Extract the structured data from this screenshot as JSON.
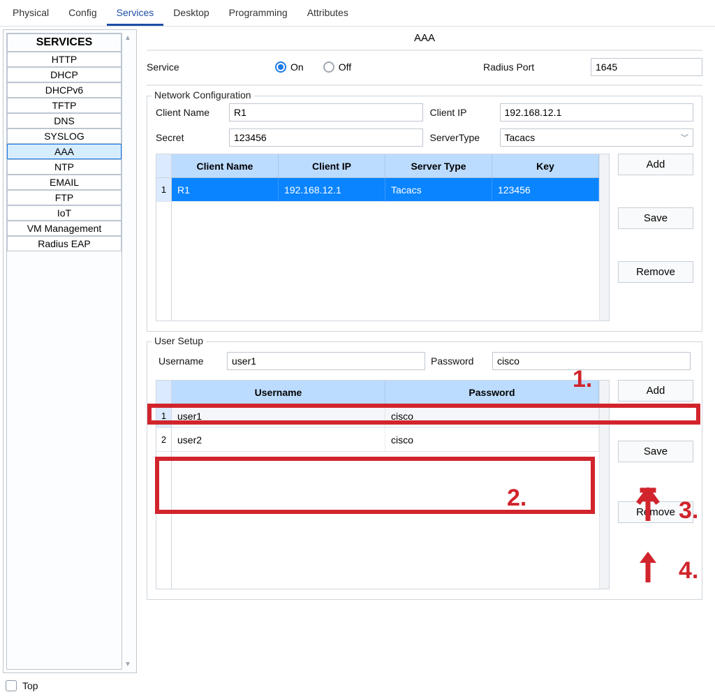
{
  "tabs": [
    "Physical",
    "Config",
    "Services",
    "Desktop",
    "Programming",
    "Attributes"
  ],
  "active_tab": "Services",
  "sidebar": {
    "title": "SERVICES",
    "items": [
      "HTTP",
      "DHCP",
      "DHCPv6",
      "TFTP",
      "DNS",
      "SYSLOG",
      "AAA",
      "NTP",
      "EMAIL",
      "FTP",
      "IoT",
      "VM Management",
      "Radius EAP"
    ],
    "selected": "AAA"
  },
  "page": {
    "title": "AAA",
    "service_label": "Service",
    "on_label": "On",
    "off_label": "Off",
    "service_on": true,
    "radius_port_label": "Radius Port",
    "radius_port": "1645"
  },
  "network_config": {
    "legend": "Network Configuration",
    "client_name_label": "Client Name",
    "client_name": "R1",
    "client_ip_label": "Client IP",
    "client_ip": "192.168.12.1",
    "secret_label": "Secret",
    "secret": "123456",
    "server_type_label": "ServerType",
    "server_type": "Tacacs",
    "headers": [
      "Client Name",
      "Client IP",
      "Server Type",
      "Key"
    ],
    "rows": [
      {
        "n": "1",
        "client": "R1",
        "ip": "192.168.12.1",
        "type": "Tacacs",
        "key": "123456",
        "selected": true
      }
    ]
  },
  "user_setup": {
    "legend": "User Setup",
    "username_label": "Username",
    "username": "user1",
    "password_label": "Password",
    "password": "cisco",
    "headers": [
      "Username",
      "Password"
    ],
    "rows": [
      {
        "n": "1",
        "user": "user1",
        "pass": "cisco",
        "alt": true
      },
      {
        "n": "2",
        "user": "user2",
        "pass": "cisco",
        "alt": false
      }
    ]
  },
  "buttons": {
    "add": "Add",
    "save": "Save",
    "remove": "Remove"
  },
  "bottom": {
    "top_label": "Top"
  },
  "annotations": {
    "a1": "1.",
    "a2": "2.",
    "a3": "3.",
    "a4": "4."
  }
}
